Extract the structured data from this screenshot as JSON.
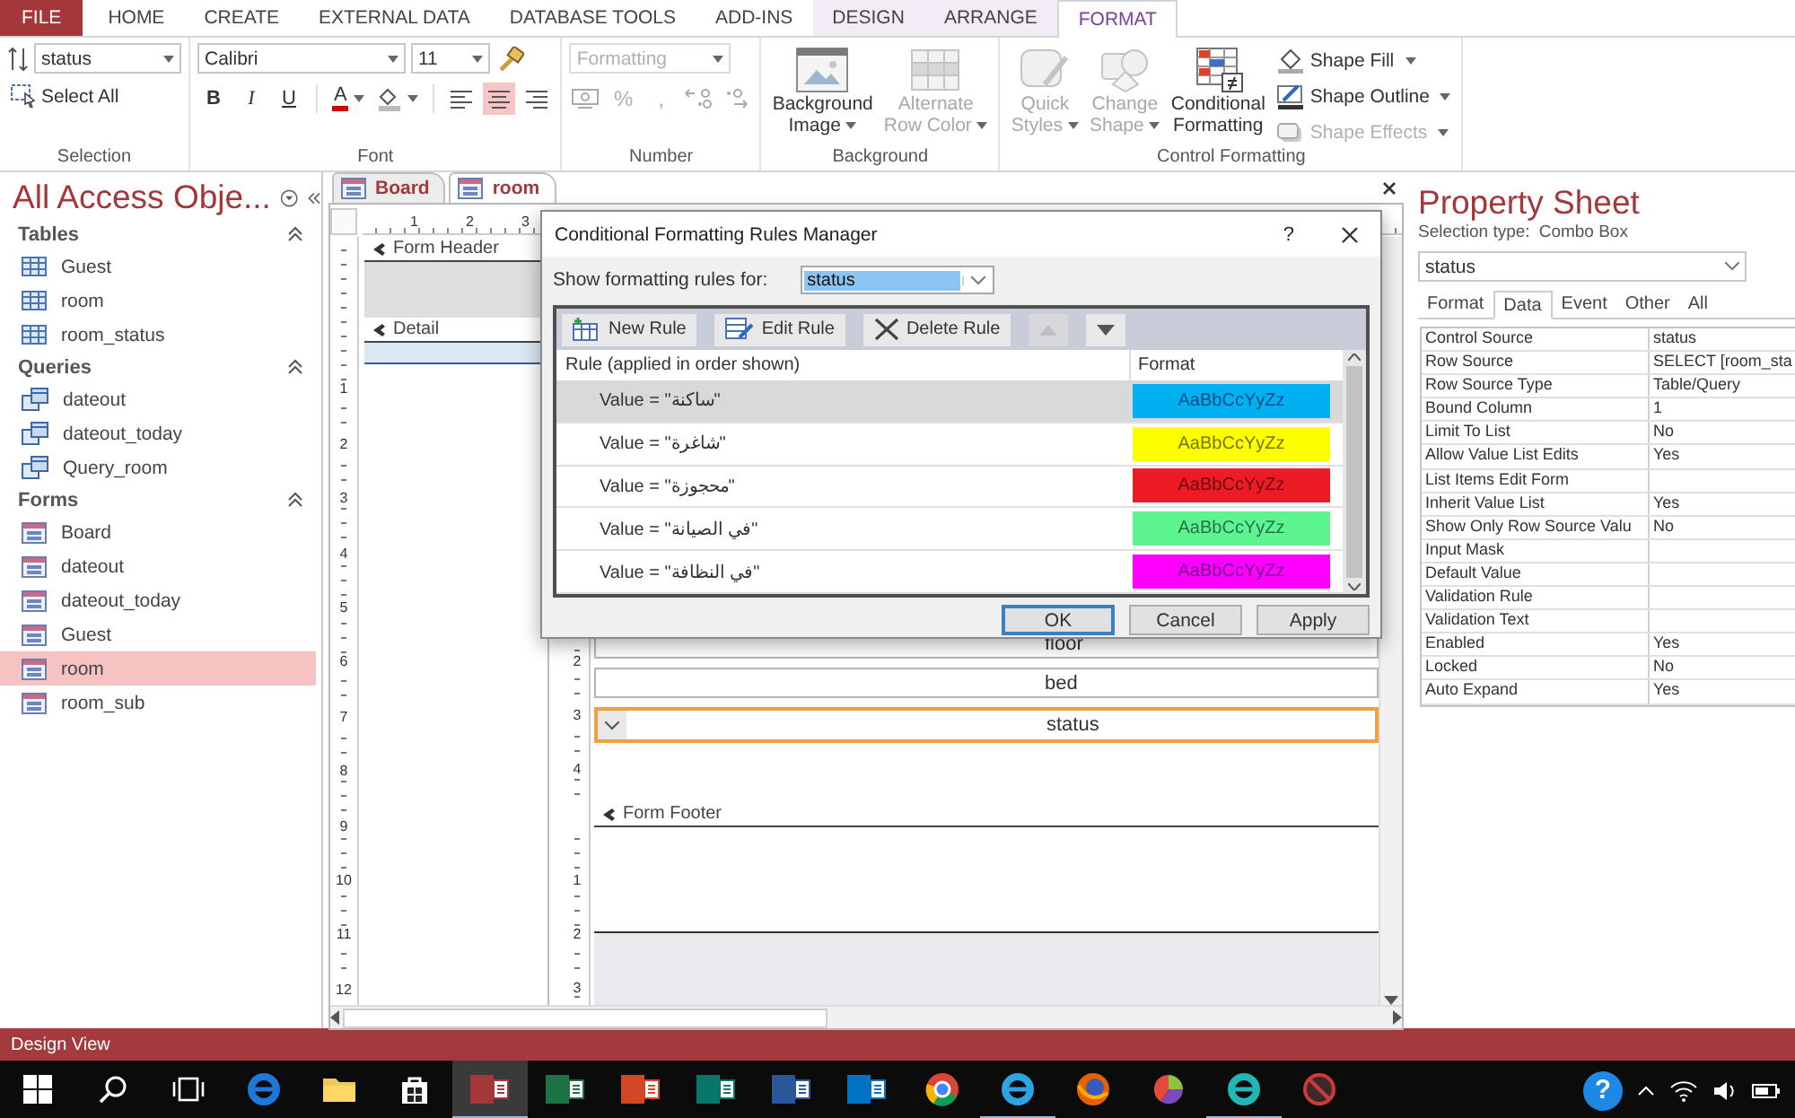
{
  "ribbon_tabs": [
    {
      "label": "FILE",
      "kind": "file",
      "selected": false
    },
    {
      "label": "HOME",
      "kind": "tab",
      "selected": false
    },
    {
      "label": "CREATE",
      "kind": "tab",
      "selected": false
    },
    {
      "label": "EXTERNAL DATA",
      "kind": "tab",
      "selected": false
    },
    {
      "label": "DATABASE TOOLS",
      "kind": "tab",
      "selected": false
    },
    {
      "label": "ADD-INS",
      "kind": "tab",
      "selected": false
    },
    {
      "label": "DESIGN",
      "kind": "contextual",
      "selected": false
    },
    {
      "label": "ARRANGE",
      "kind": "contextual",
      "selected": false
    },
    {
      "label": "FORMAT",
      "kind": "contextual",
      "selected": true
    }
  ],
  "ribbon": {
    "selection": {
      "object_combo": "status",
      "select_all": "Select All",
      "label": "Selection"
    },
    "font": {
      "font_combo": "Calibri",
      "size_combo": "11",
      "styles": [
        "B",
        "I",
        "U"
      ],
      "font_color": "A",
      "alignment": [
        {
          "kind": "left",
          "selected": false
        },
        {
          "kind": "center",
          "selected": true
        },
        {
          "kind": "right",
          "selected": false
        }
      ],
      "label": "Font"
    },
    "number": {
      "format_combo": "Formatting",
      "disabled": true,
      "buttons": [
        {
          "kind": "currency"
        },
        {
          "kind": "text",
          "label": "%"
        },
        {
          "kind": "text",
          "label": ","
        },
        {
          "kind": "increase-decimal"
        },
        {
          "kind": "decrease-decimal"
        }
      ],
      "label": "Number"
    },
    "background": {
      "buttons": [
        {
          "label": "Background Image",
          "kind": "image",
          "disabled": false,
          "dropdown": true
        },
        {
          "label": "Alternate Row Color",
          "kind": "grid",
          "disabled": true,
          "dropdown": true
        }
      ],
      "label": "Background"
    },
    "control_formatting": {
      "large_buttons": [
        {
          "label": "Quick Styles",
          "kind": "styles",
          "disabled": true,
          "dropdown": true
        },
        {
          "label": "Change Shape",
          "kind": "shape",
          "disabled": true,
          "dropdown": true
        },
        {
          "label": "Conditional Formatting",
          "kind": "conditional",
          "disabled": false,
          "dropdown": false
        }
      ],
      "small_buttons": [
        {
          "label": "Shape Fill",
          "kind": "fill",
          "disabled": false
        },
        {
          "label": "Shape Outline",
          "kind": "outline",
          "disabled": false
        },
        {
          "label": "Shape Effects",
          "kind": "effects",
          "disabled": true
        }
      ],
      "label": "Control Formatting"
    }
  },
  "nav": {
    "title": "All Access Obje...",
    "groups": [
      {
        "label": "Tables",
        "kind": "table",
        "expanded": true,
        "items": [
          {
            "label": "Guest",
            "selected": false
          },
          {
            "label": "room",
            "selected": false
          },
          {
            "label": "room_status",
            "selected": false
          }
        ]
      },
      {
        "label": "Queries",
        "kind": "query",
        "expanded": true,
        "items": [
          {
            "label": "dateout",
            "selected": false
          },
          {
            "label": "dateout_today",
            "selected": false
          },
          {
            "label": "Query_room",
            "selected": false
          }
        ]
      },
      {
        "label": "Forms",
        "kind": "form",
        "expanded": true,
        "items": [
          {
            "label": "Board",
            "selected": false
          },
          {
            "label": "dateout",
            "selected": false
          },
          {
            "label": "dateout_today",
            "selected": false
          },
          {
            "label": "Guest",
            "selected": false
          },
          {
            "label": "room",
            "selected": true
          },
          {
            "label": "room_sub",
            "selected": false
          }
        ]
      }
    ]
  },
  "document": {
    "tabs": [
      {
        "label": "Board",
        "selected": false
      },
      {
        "label": "room",
        "selected": true
      }
    ],
    "top_ruler": [
      "1",
      "2",
      "3"
    ],
    "left_ruler": [
      "1",
      "2",
      "3",
      "4",
      "5",
      "6",
      "7",
      "8",
      "9",
      "10",
      "11",
      "12"
    ],
    "form_header": "Form Header",
    "detail": "Detail",
    "subform": {
      "ruler": [
        "2",
        "3",
        "4"
      ],
      "controls": [
        {
          "label": "floor",
          "kind": "textbox",
          "selected": false
        },
        {
          "label": "bed",
          "kind": "textbox",
          "selected": false
        },
        {
          "label": "status",
          "kind": "combo",
          "selected": true
        }
      ],
      "footer": "Form Footer",
      "footer_ruler": [
        "1",
        "2",
        "3"
      ]
    }
  },
  "dialog": {
    "title": "Conditional Formatting Rules Manager",
    "help": "?",
    "show_label": "Show formatting rules for:",
    "show_combo": "status",
    "toolbar": [
      {
        "label": "New Rule",
        "kind": "new",
        "disabled": false
      },
      {
        "label": "Edit Rule",
        "kind": "edit",
        "disabled": false
      },
      {
        "label": "Delete Rule",
        "kind": "delete",
        "disabled": false
      },
      {
        "kind": "up",
        "disabled": true
      },
      {
        "kind": "down",
        "disabled": false
      }
    ],
    "columns": [
      "Rule (applied in order shown)",
      "Format"
    ],
    "rules": [
      {
        "rule": "Value = \"ساكنة\"",
        "preview": "AaBbCcYyZz",
        "color": "#00b0f0",
        "selected": true
      },
      {
        "rule": "Value = \"شاغرة\"",
        "preview": "AaBbCcYyZz",
        "color": "#ffff00",
        "selected": false
      },
      {
        "rule": "Value = \"محجوزة\"",
        "preview": "AaBbCcYyZz",
        "color": "#ed1c24",
        "selected": false
      },
      {
        "rule": "Value = \"في الصيانة\"",
        "preview": "AaBbCcYyZz",
        "color": "#5cf58f",
        "selected": false
      },
      {
        "rule": "Value = \"في النظافة\"",
        "preview": "AaBbCcYyZz",
        "color": "#ff00ff",
        "selected": false
      }
    ],
    "buttons": [
      {
        "label": "OK",
        "default": true
      },
      {
        "label": "Cancel",
        "default": false
      },
      {
        "label": "Apply",
        "default": false
      }
    ]
  },
  "property_sheet": {
    "title": "Property Sheet",
    "selection_type_label": "Selection type:",
    "selection_type": "Combo Box",
    "object_combo": "status",
    "tabs": [
      {
        "label": "Format",
        "selected": false
      },
      {
        "label": "Data",
        "selected": true
      },
      {
        "label": "Event",
        "selected": false
      },
      {
        "label": "Other",
        "selected": false
      },
      {
        "label": "All",
        "selected": false
      }
    ],
    "rows": [
      {
        "name": "Control Source",
        "value": "status"
      },
      {
        "name": "Row Source",
        "value": "SELECT [room_sta"
      },
      {
        "name": "Row Source Type",
        "value": "Table/Query"
      },
      {
        "name": "Bound Column",
        "value": "1"
      },
      {
        "name": "Limit To List",
        "value": "No"
      },
      {
        "name": "Allow Value List Edits",
        "value": "Yes"
      },
      {
        "name": "List Items Edit Form"
      },
      {
        "name": "Inherit Value List",
        "value": "Yes"
      },
      {
        "name": "Show Only Row Source Valu",
        "value": "No"
      },
      {
        "name": "Input Mask"
      },
      {
        "name": "Default Value"
      },
      {
        "name": "Validation Rule"
      },
      {
        "name": "Validation Text"
      },
      {
        "name": "Enabled",
        "value": "Yes"
      },
      {
        "name": "Locked",
        "value": "No"
      },
      {
        "name": "Auto Expand",
        "value": "Yes"
      }
    ]
  },
  "status_bar": "Design View",
  "taskbar": {
    "items": [
      {
        "kind": "start",
        "selected": false,
        "running": false
      },
      {
        "kind": "search",
        "selected": false,
        "running": false
      },
      {
        "kind": "task-view",
        "selected": false,
        "running": false
      },
      {
        "kind": "ring",
        "color": "#1e78d7",
        "selected": false,
        "running": false
      },
      {
        "kind": "folder",
        "selected": false,
        "running": false
      },
      {
        "kind": "store",
        "selected": false,
        "running": false
      },
      {
        "kind": "tile",
        "color": "#a4373a",
        "selected": true,
        "running": true
      },
      {
        "kind": "tile",
        "color": "#1e7145",
        "selected": false,
        "running": false
      },
      {
        "kind": "tile",
        "color": "#d24726",
        "selected": false,
        "running": false
      },
      {
        "kind": "tile",
        "color": "#077568",
        "selected": false,
        "running": false
      },
      {
        "kind": "tile",
        "color": "#2b579a",
        "selected": false,
        "running": false
      },
      {
        "kind": "tile",
        "color": "#0072c6",
        "selected": false,
        "running": false
      },
      {
        "kind": "wheel",
        "selected": false,
        "running": false
      },
      {
        "kind": "ring",
        "color": "#2ea3e3",
        "selected": false,
        "running": true
      },
      {
        "kind": "ball",
        "color": "#e66000",
        "selected": false,
        "running": false
      },
      {
        "kind": "pie",
        "selected": false,
        "running": false
      },
      {
        "kind": "ring",
        "color": "#24b5b5",
        "selected": false,
        "running": true
      },
      {
        "kind": "blocked",
        "selected": false,
        "running": false
      }
    ],
    "help": "?"
  }
}
